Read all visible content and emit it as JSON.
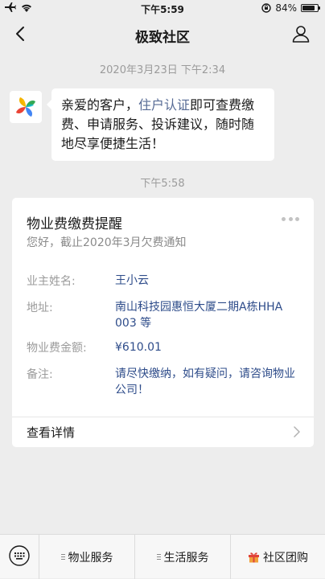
{
  "status_bar": {
    "time": "下午5:59",
    "battery": "84%",
    "battery_level": 0.84
  },
  "nav": {
    "title": "极致社区"
  },
  "chat": {
    "timestamp_1": "2020年3月23日 下午2:34",
    "message": {
      "prefix": "亲爱的客户，",
      "link": "住户认证",
      "suffix": "即可查费缴费、申请服务、投诉建议，随时随地尽享便捷生活！"
    },
    "timestamp_2": "下午5:58"
  },
  "card": {
    "title": "物业费缴费提醒",
    "subtitle": "您好，截止2020年3月欠费通知",
    "fields": [
      {
        "label": "业主姓名:",
        "value": "王小云"
      },
      {
        "label": "地址:",
        "value": "南山科技园惠恒大厦二期A栋HHA003 等"
      },
      {
        "label": "物业费金额:",
        "value": "¥610.01"
      },
      {
        "label": "备注:",
        "value": "请尽快缴纳，如有疑问，请咨询物业公司！"
      }
    ],
    "footer_label": "查看详情"
  },
  "bottom_menu": {
    "items": [
      {
        "label": "物业服务"
      },
      {
        "label": "生活服务"
      },
      {
        "label": "社区团购"
      }
    ]
  },
  "icons": {
    "status_left": [
      "airplane-icon",
      "wifi-icon"
    ],
    "status_right": [
      "rotation-lock-icon",
      "battery-icon"
    ],
    "nav": [
      "back-icon",
      "user-icon"
    ],
    "avatar": "pinwheel-logo-icon",
    "card_more": "more-icon",
    "card_footer": "chevron-right-icon",
    "bottom": [
      "keyboard-icon",
      "menu-lines-icon",
      "gift-icon"
    ]
  },
  "colors": {
    "background": "#ededed",
    "link": "#576b95",
    "field_value": "#2e4c8a",
    "muted": "#9b9b9b"
  }
}
